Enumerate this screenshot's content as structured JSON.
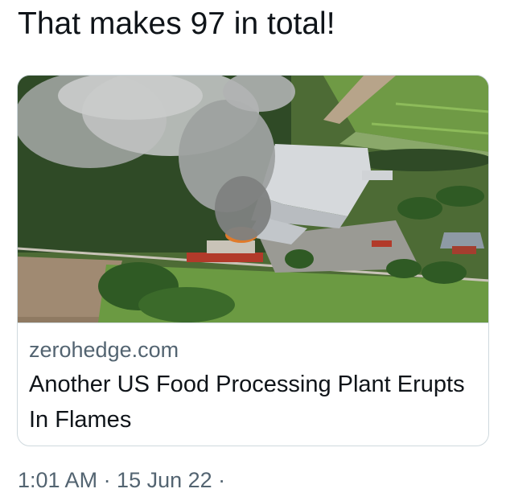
{
  "tweet": {
    "text": "That makes 97 in total!"
  },
  "card": {
    "image": {
      "subject": "aerial view of burning food processing plant"
    },
    "domain": "zerohedge.com",
    "title": "Another US Food Processing Plant Erupts In Flames"
  },
  "meta": {
    "timestamp": "1:01 AM · 15 Jun 22 ·"
  },
  "colors": {
    "text_primary": "#0f1419",
    "text_secondary": "#536471",
    "card_border": "#cfd9de"
  }
}
